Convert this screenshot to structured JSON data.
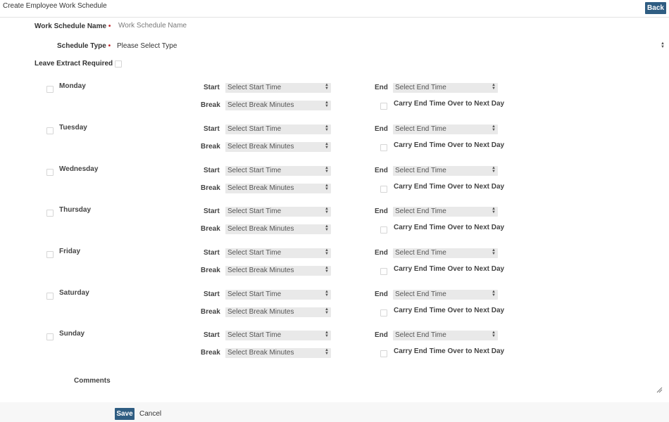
{
  "header": {
    "title": "Create Employee Work Schedule",
    "back_label": "Back"
  },
  "form": {
    "name_label": "Work Schedule Name",
    "name_placeholder": "Work Schedule Name",
    "required_mark": "•",
    "type_label": "Schedule Type",
    "type_value": "Please Select Type",
    "leave_label": "Leave Extract Required",
    "start_label": "Start",
    "end_label": "End",
    "break_label": "Break",
    "start_placeholder": "Select Start Time",
    "end_placeholder": "Select End Time",
    "break_placeholder": "Select Break Minutes",
    "carry_label": "Carry End Time Over to Next Day",
    "days": [
      {
        "name": "Monday"
      },
      {
        "name": "Tuesday"
      },
      {
        "name": "Wednesday"
      },
      {
        "name": "Thursday"
      },
      {
        "name": "Friday"
      },
      {
        "name": "Saturday"
      },
      {
        "name": "Sunday"
      }
    ],
    "comments_label": "Comments"
  },
  "footer": {
    "save_label": "Save",
    "cancel_label": "Cancel"
  },
  "icons": {
    "select_arrow": "up-down-arrows-icon",
    "resize": "resize-grip-icon"
  },
  "colors": {
    "primary": "#2f5d82",
    "required": "#c1272d",
    "select_bg": "#e9e9e9"
  }
}
